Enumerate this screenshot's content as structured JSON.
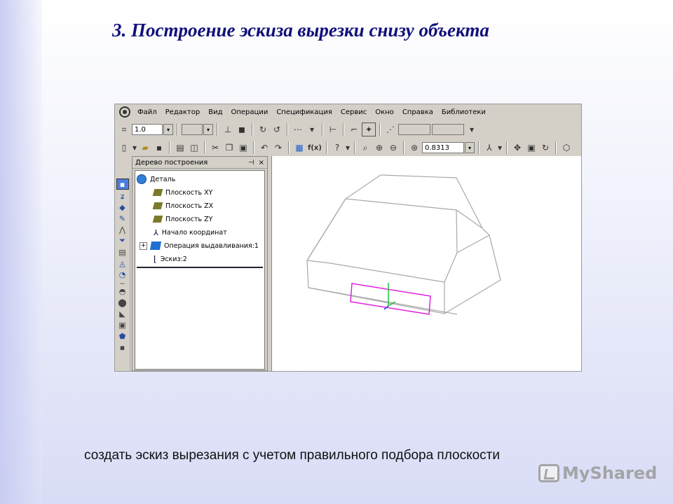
{
  "slide": {
    "title": "3. Построение эскиза вырезки снизу объекта",
    "caption": "создать эскиз вырезания с учетом правильного подбора плоскости",
    "watermark": "MyShared"
  },
  "app": {
    "menu": [
      "Файл",
      "Редактор",
      "Вид",
      "Операции",
      "Спецификация",
      "Сервис",
      "Окно",
      "Справка",
      "Библиотеки"
    ],
    "toolbar1": {
      "step_value": "1.0"
    },
    "toolbar2": {
      "zoom_value": "0.8313",
      "fx_label": "f(x)"
    },
    "tree": {
      "title": "Дерево построения",
      "pin": "ᵖ",
      "close": "×",
      "items": [
        {
          "label": "Деталь",
          "icon": "part-icon"
        },
        {
          "label": "Плоскость XY",
          "icon": "plane-icon"
        },
        {
          "label": "Плоскость ZX",
          "icon": "plane-icon"
        },
        {
          "label": "Плоскость ZY",
          "icon": "plane-icon"
        },
        {
          "label": "Начало координат",
          "icon": "origin-icon"
        },
        {
          "label": "Операция выдавливания:1",
          "icon": "extrude-icon"
        },
        {
          "label": "Эскиз:2",
          "icon": "sketch-icon"
        }
      ]
    },
    "colors": {
      "model_edges": "#a8a8a8",
      "sketch_rect": "#e020e0",
      "axis_green": "#20c040",
      "axis_blue": "#2040e0"
    }
  }
}
